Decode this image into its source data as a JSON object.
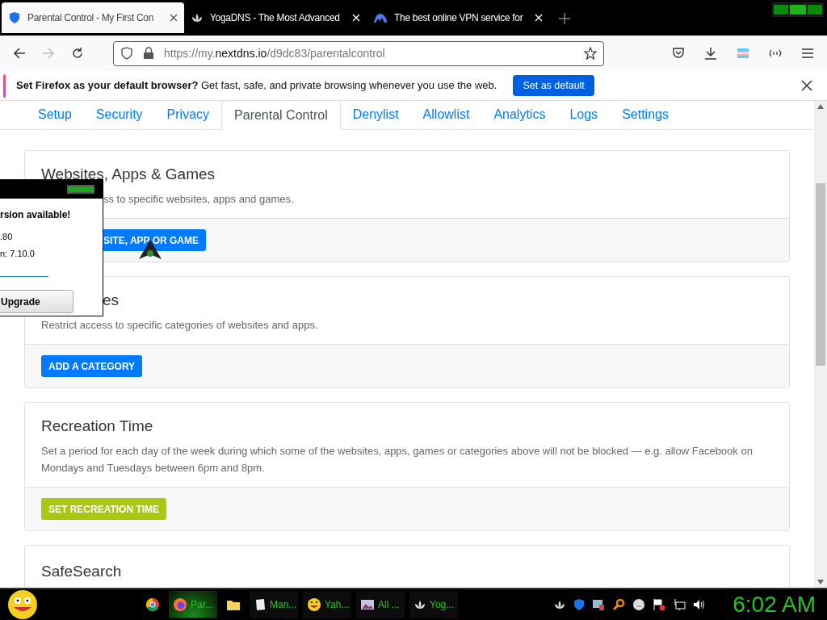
{
  "browser_tabs": [
    {
      "title": "Parental Control - My First Con",
      "selected": true
    },
    {
      "title": "YogaDNS - The Most Advanced",
      "selected": false
    },
    {
      "title": "The best online VPN service for",
      "selected": false
    }
  ],
  "address": {
    "prefix": "https://my.",
    "domain": "nextdns.io",
    "path": "/d9dc83/parentalcontrol"
  },
  "notification": {
    "text": "**Set Firefox as your default browser?** Get fast, safe, and private browsing whenever you use the web.",
    "button": "Set as default"
  },
  "nav_tabs": [
    {
      "label": "Setup",
      "selected": false
    },
    {
      "label": "Security",
      "selected": false
    },
    {
      "label": "Privacy",
      "selected": false
    },
    {
      "label": "Parental Control",
      "selected": true
    },
    {
      "label": "Denylist",
      "selected": false
    },
    {
      "label": "Allowlist",
      "selected": false
    },
    {
      "label": "Analytics",
      "selected": false
    },
    {
      "label": "Logs",
      "selected": false
    },
    {
      "label": "Settings",
      "selected": false
    }
  ],
  "cards": [
    {
      "title": "Websites, Apps & Games",
      "description": "ss to specific websites, apps and games.",
      "button": "SITE, APP OR GAME",
      "kind": "primary"
    },
    {
      "title": "es",
      "description": "Restrict access to specific categories of websites and apps.",
      "button": "ADD A CATEGORY",
      "kind": "primary"
    },
    {
      "title": "Recreation Time",
      "description": "Set a period for each day of the week during which some of the websites, apps, games or categories above will not be blocked — e.g. allow Facebook on Mondays and Tuesdays between 6pm and 8pm.",
      "button": "SET RECREATION TIME",
      "kind": "lime"
    },
    {
      "title": "SafeSearch"
    }
  ],
  "popup": {
    "heading": "rsion available!",
    "line_1": ".80",
    "line_2": "n: 7.10.0",
    "button": "Upgrade"
  },
  "taskbar": {
    "items": [
      {
        "selected": false
      },
      {
        "label": "Par...",
        "selected": true
      },
      {
        "selected": false
      },
      {
        "label": "Man...",
        "selected": false
      },
      {
        "label": "Yah...",
        "selected": false
      },
      {
        "label": "All ...",
        "selected": false
      },
      {
        "label": "Yog...",
        "selected": false
      }
    ],
    "clock": "6:02 AM"
  }
}
